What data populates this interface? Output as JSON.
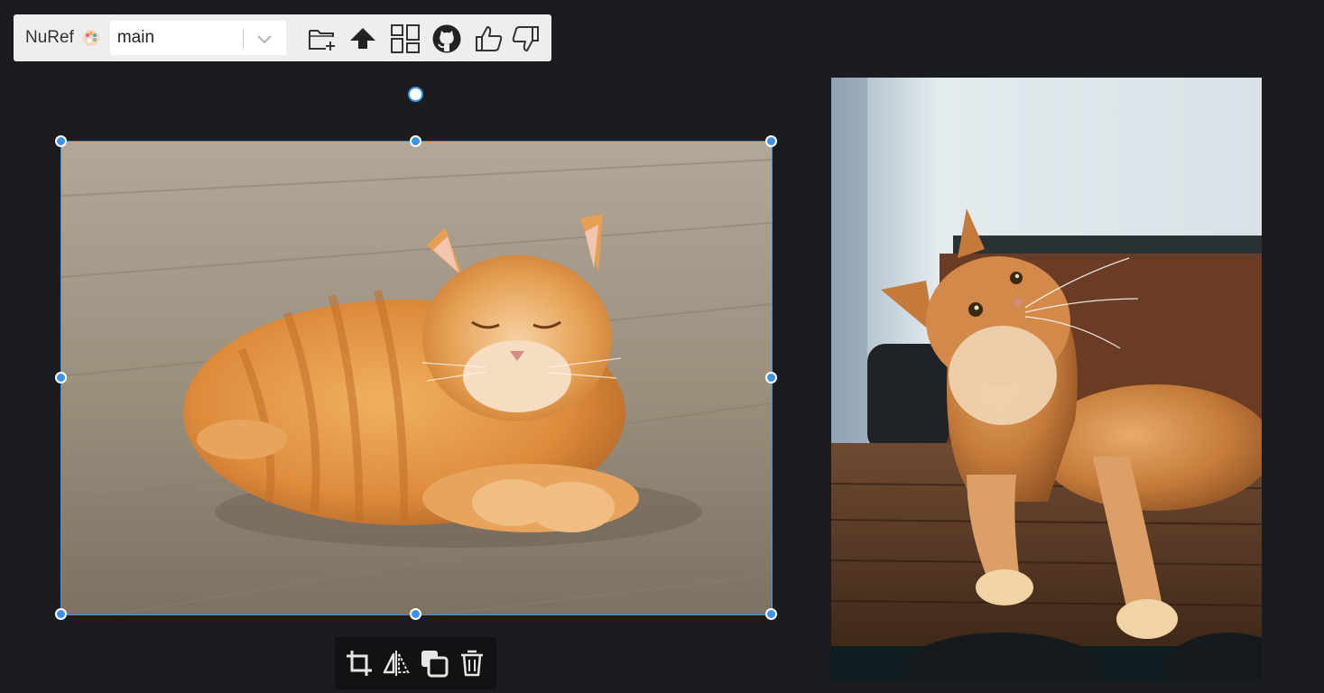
{
  "toolbar": {
    "app_name": "NuRef",
    "palette_icon": "palette-icon",
    "board_select": {
      "value": "main",
      "icon": "chevron-down-icon"
    },
    "buttons": [
      {
        "name": "new-folder-button",
        "icon": "folder-plus-icon"
      },
      {
        "name": "upload-button",
        "icon": "upload-arrow-icon"
      },
      {
        "name": "layout-button",
        "icon": "layout-grid-icon"
      },
      {
        "name": "github-button",
        "icon": "github-icon"
      },
      {
        "name": "thumbs-up-button",
        "icon": "thumbs-up-icon"
      },
      {
        "name": "thumbs-down-button",
        "icon": "thumbs-down-icon"
      }
    ]
  },
  "canvas": {
    "images": [
      {
        "name": "sleeping-orange-cat-image",
        "selected": true
      },
      {
        "name": "maine-coon-cat-image",
        "selected": false
      }
    ]
  },
  "selection_toolbar": {
    "buttons": [
      {
        "name": "crop-button",
        "icon": "crop-icon"
      },
      {
        "name": "flip-button",
        "icon": "flip-horizontal-icon"
      },
      {
        "name": "bring-forward-button",
        "icon": "layers-icon"
      },
      {
        "name": "delete-button",
        "icon": "trash-icon"
      }
    ]
  },
  "colors": {
    "background": "#1b1c1f",
    "toolbar_bg": "#eeeeee",
    "selection_accent": "#3b92e8"
  }
}
